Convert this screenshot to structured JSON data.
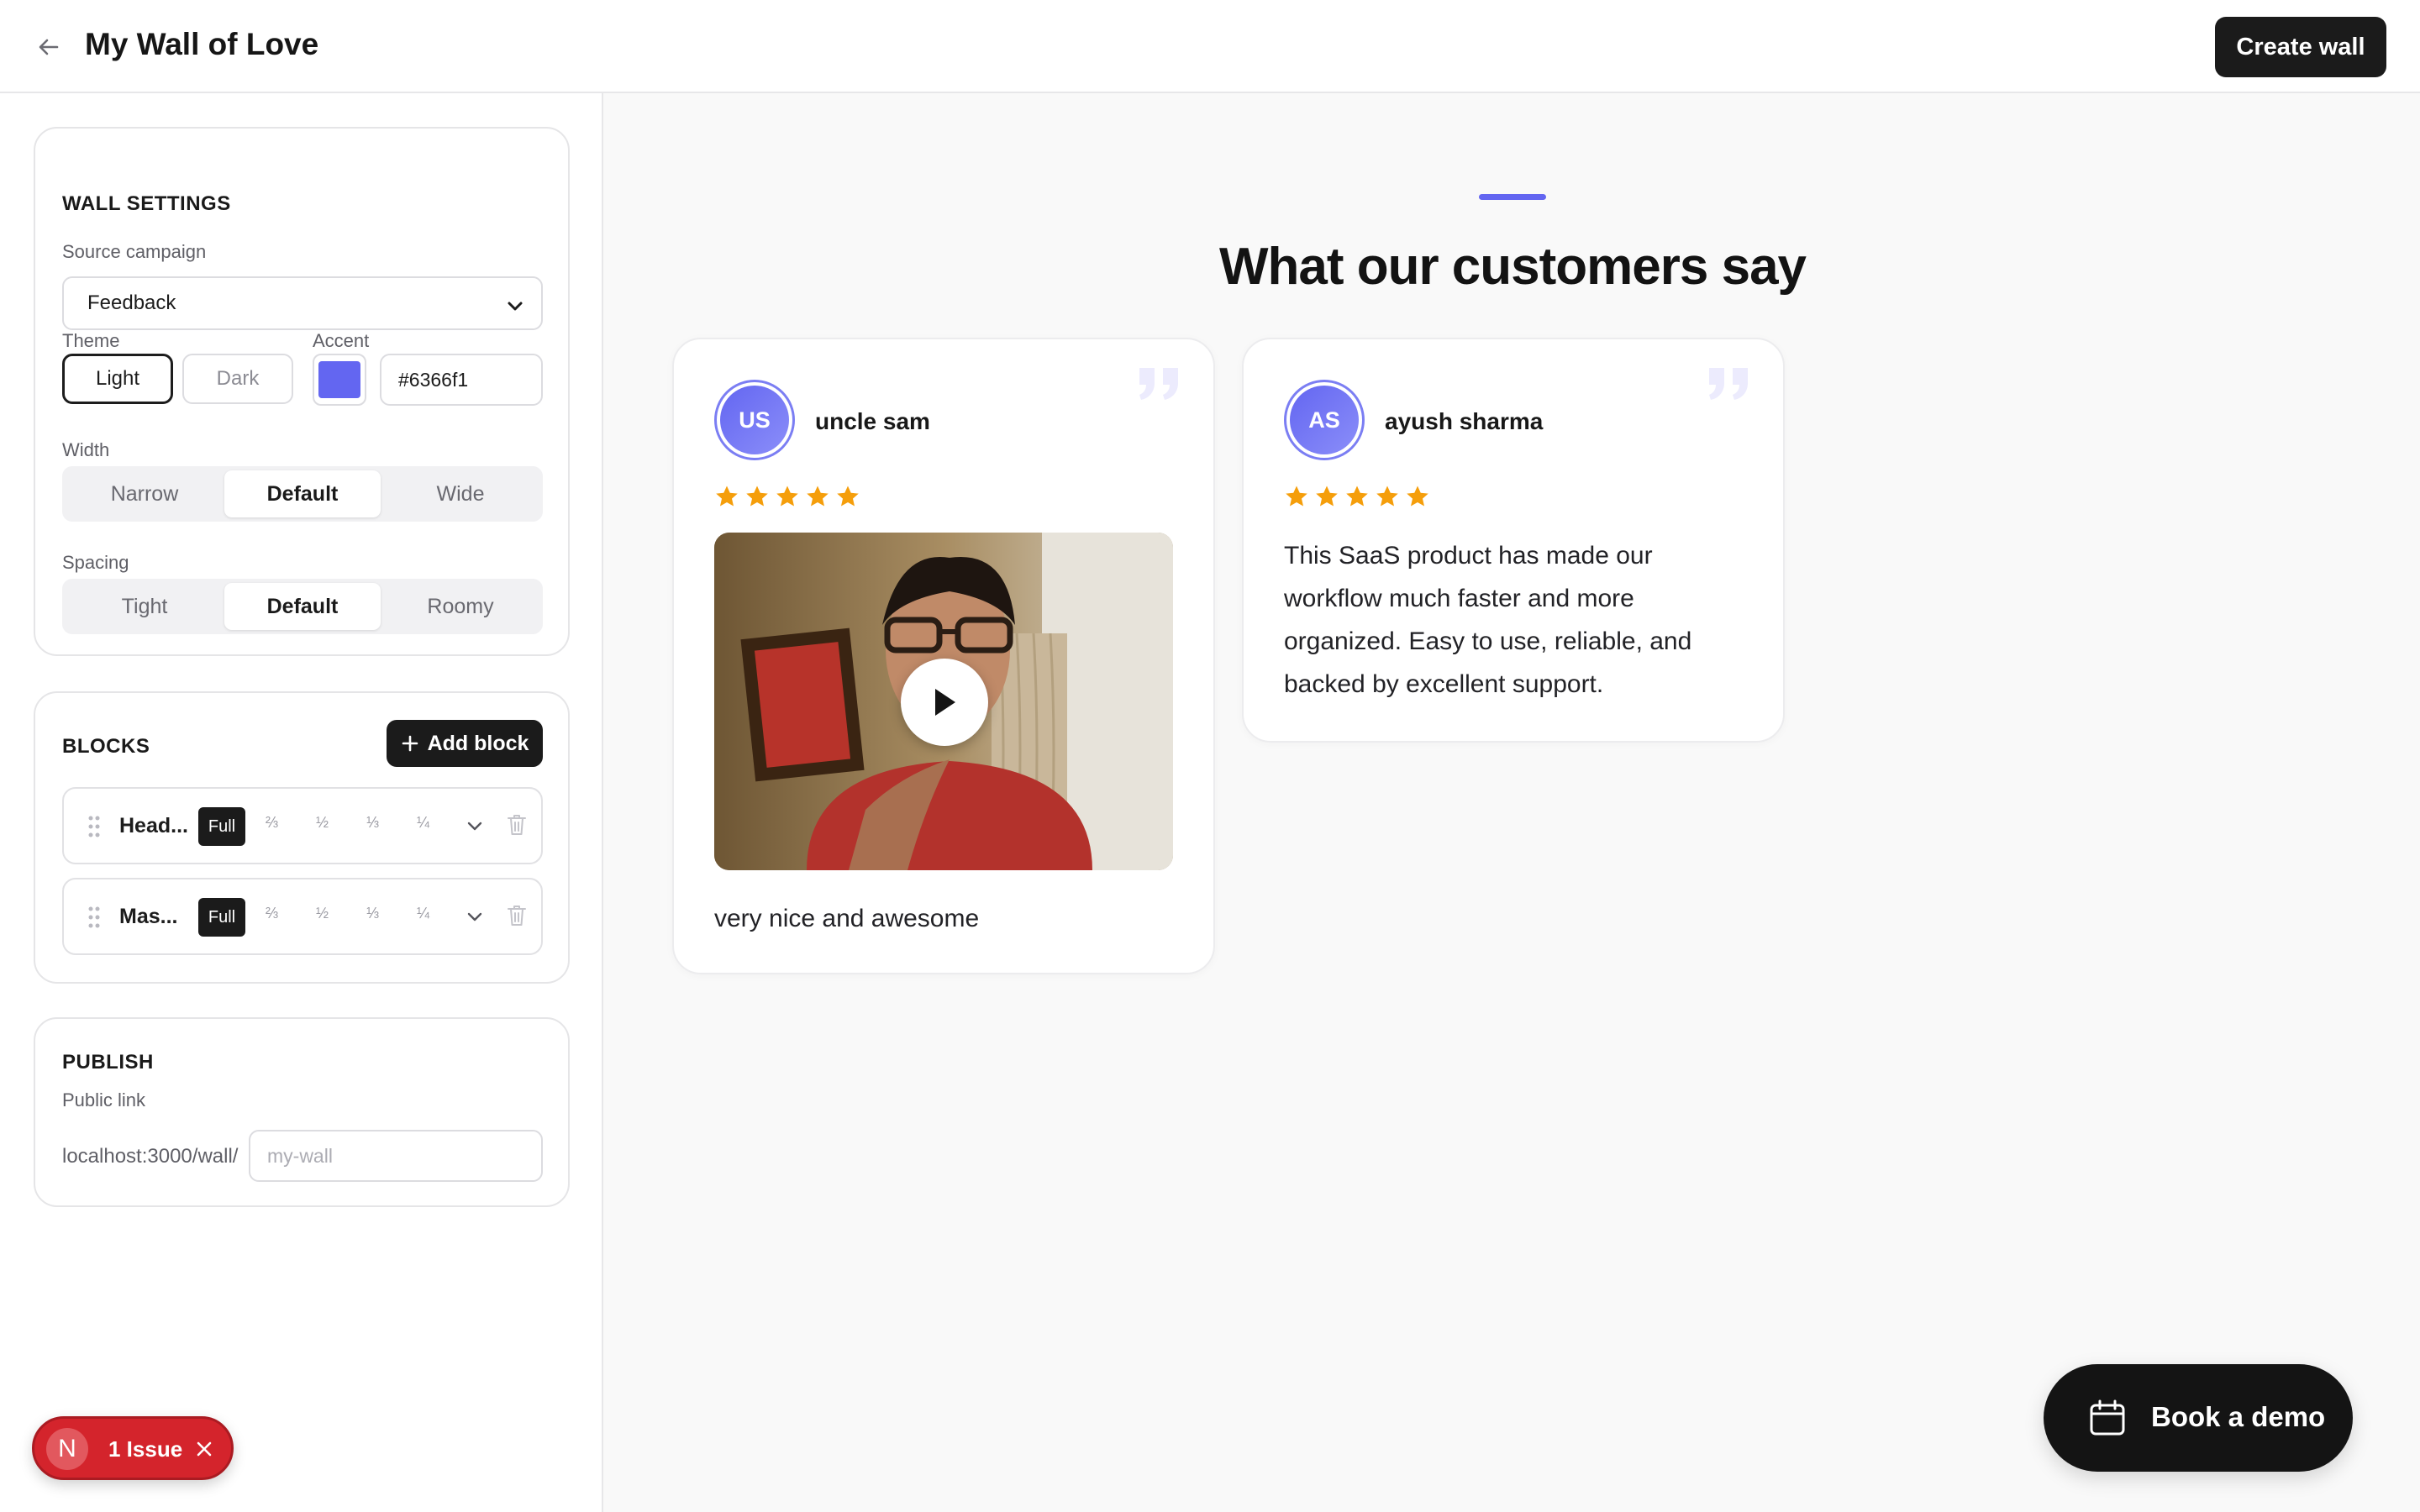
{
  "header": {
    "title": "My Wall of Love",
    "create_label": "Create wall"
  },
  "settings": {
    "heading": "WALL SETTINGS",
    "source_label": "Source campaign",
    "source_value": "Feedback",
    "theme_label": "Theme",
    "theme_options": [
      "Light",
      "Dark"
    ],
    "theme_selected": "Light",
    "accent_label": "Accent",
    "accent_value": "#6366f1",
    "width_label": "Width",
    "width_options": [
      "Narrow",
      "Default",
      "Wide"
    ],
    "width_selected": "Default",
    "spacing_label": "Spacing",
    "spacing_options": [
      "Tight",
      "Default",
      "Roomy"
    ],
    "spacing_selected": "Default"
  },
  "blocks": {
    "heading": "BLOCKS",
    "add_label": "Add block",
    "size_options": [
      "Full",
      "⅔",
      "½",
      "⅓",
      "¼"
    ],
    "items": [
      {
        "name": "Head...",
        "size": "Full"
      },
      {
        "name": "Mas...",
        "size": "Full"
      }
    ]
  },
  "publish": {
    "heading": "PUBLISH",
    "link_label": "Public link",
    "url_prefix": "localhost:3000/wall/",
    "slug_placeholder": "my-wall",
    "slug_value": ""
  },
  "dev_overlay": {
    "badge": "N",
    "issues_label": "1 Issue"
  },
  "preview": {
    "heading": "What our customers say",
    "testimonials": [
      {
        "initials": "US",
        "author": "uncle sam",
        "rating": 5,
        "has_video": true,
        "text": "very nice and awesome"
      },
      {
        "initials": "AS",
        "author": "ayush sharma",
        "rating": 5,
        "has_video": false,
        "text": "This SaaS product has made our workflow much faster and more organized. Easy to use, reliable, and backed by excellent support."
      }
    ]
  },
  "cta": {
    "label": "Book a demo"
  },
  "colors": {
    "accent": "#6366f1",
    "star": "#f59e0b",
    "dark_button": "#1b1b1b",
    "issue_red": "#d4242c"
  },
  "icons": [
    "arrow-left-icon",
    "chevron-down-icon",
    "plus-icon",
    "drag-handle-icon",
    "trash-icon",
    "close-icon",
    "quote-icon",
    "star-icon",
    "play-icon",
    "calendar-icon"
  ]
}
